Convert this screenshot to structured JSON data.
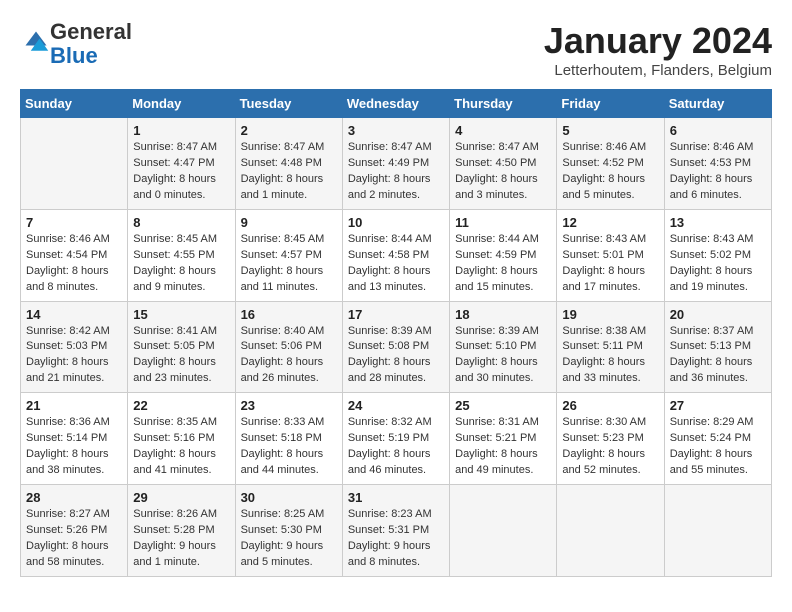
{
  "logo": {
    "general": "General",
    "blue": "Blue"
  },
  "title": "January 2024",
  "subtitle": "Letterhoutem, Flanders, Belgium",
  "weekdays": [
    "Sunday",
    "Monday",
    "Tuesday",
    "Wednesday",
    "Thursday",
    "Friday",
    "Saturday"
  ],
  "weeks": [
    [
      {
        "day": "",
        "info": ""
      },
      {
        "day": "1",
        "info": "Sunrise: 8:47 AM\nSunset: 4:47 PM\nDaylight: 8 hours\nand 0 minutes."
      },
      {
        "day": "2",
        "info": "Sunrise: 8:47 AM\nSunset: 4:48 PM\nDaylight: 8 hours\nand 1 minute."
      },
      {
        "day": "3",
        "info": "Sunrise: 8:47 AM\nSunset: 4:49 PM\nDaylight: 8 hours\nand 2 minutes."
      },
      {
        "day": "4",
        "info": "Sunrise: 8:47 AM\nSunset: 4:50 PM\nDaylight: 8 hours\nand 3 minutes."
      },
      {
        "day": "5",
        "info": "Sunrise: 8:46 AM\nSunset: 4:52 PM\nDaylight: 8 hours\nand 5 minutes."
      },
      {
        "day": "6",
        "info": "Sunrise: 8:46 AM\nSunset: 4:53 PM\nDaylight: 8 hours\nand 6 minutes."
      }
    ],
    [
      {
        "day": "7",
        "info": "Sunrise: 8:46 AM\nSunset: 4:54 PM\nDaylight: 8 hours\nand 8 minutes."
      },
      {
        "day": "8",
        "info": "Sunrise: 8:45 AM\nSunset: 4:55 PM\nDaylight: 8 hours\nand 9 minutes."
      },
      {
        "day": "9",
        "info": "Sunrise: 8:45 AM\nSunset: 4:57 PM\nDaylight: 8 hours\nand 11 minutes."
      },
      {
        "day": "10",
        "info": "Sunrise: 8:44 AM\nSunset: 4:58 PM\nDaylight: 8 hours\nand 13 minutes."
      },
      {
        "day": "11",
        "info": "Sunrise: 8:44 AM\nSunset: 4:59 PM\nDaylight: 8 hours\nand 15 minutes."
      },
      {
        "day": "12",
        "info": "Sunrise: 8:43 AM\nSunset: 5:01 PM\nDaylight: 8 hours\nand 17 minutes."
      },
      {
        "day": "13",
        "info": "Sunrise: 8:43 AM\nSunset: 5:02 PM\nDaylight: 8 hours\nand 19 minutes."
      }
    ],
    [
      {
        "day": "14",
        "info": "Sunrise: 8:42 AM\nSunset: 5:03 PM\nDaylight: 8 hours\nand 21 minutes."
      },
      {
        "day": "15",
        "info": "Sunrise: 8:41 AM\nSunset: 5:05 PM\nDaylight: 8 hours\nand 23 minutes."
      },
      {
        "day": "16",
        "info": "Sunrise: 8:40 AM\nSunset: 5:06 PM\nDaylight: 8 hours\nand 26 minutes."
      },
      {
        "day": "17",
        "info": "Sunrise: 8:39 AM\nSunset: 5:08 PM\nDaylight: 8 hours\nand 28 minutes."
      },
      {
        "day": "18",
        "info": "Sunrise: 8:39 AM\nSunset: 5:10 PM\nDaylight: 8 hours\nand 30 minutes."
      },
      {
        "day": "19",
        "info": "Sunrise: 8:38 AM\nSunset: 5:11 PM\nDaylight: 8 hours\nand 33 minutes."
      },
      {
        "day": "20",
        "info": "Sunrise: 8:37 AM\nSunset: 5:13 PM\nDaylight: 8 hours\nand 36 minutes."
      }
    ],
    [
      {
        "day": "21",
        "info": "Sunrise: 8:36 AM\nSunset: 5:14 PM\nDaylight: 8 hours\nand 38 minutes."
      },
      {
        "day": "22",
        "info": "Sunrise: 8:35 AM\nSunset: 5:16 PM\nDaylight: 8 hours\nand 41 minutes."
      },
      {
        "day": "23",
        "info": "Sunrise: 8:33 AM\nSunset: 5:18 PM\nDaylight: 8 hours\nand 44 minutes."
      },
      {
        "day": "24",
        "info": "Sunrise: 8:32 AM\nSunset: 5:19 PM\nDaylight: 8 hours\nand 46 minutes."
      },
      {
        "day": "25",
        "info": "Sunrise: 8:31 AM\nSunset: 5:21 PM\nDaylight: 8 hours\nand 49 minutes."
      },
      {
        "day": "26",
        "info": "Sunrise: 8:30 AM\nSunset: 5:23 PM\nDaylight: 8 hours\nand 52 minutes."
      },
      {
        "day": "27",
        "info": "Sunrise: 8:29 AM\nSunset: 5:24 PM\nDaylight: 8 hours\nand 55 minutes."
      }
    ],
    [
      {
        "day": "28",
        "info": "Sunrise: 8:27 AM\nSunset: 5:26 PM\nDaylight: 8 hours\nand 58 minutes."
      },
      {
        "day": "29",
        "info": "Sunrise: 8:26 AM\nSunset: 5:28 PM\nDaylight: 9 hours\nand 1 minute."
      },
      {
        "day": "30",
        "info": "Sunrise: 8:25 AM\nSunset: 5:30 PM\nDaylight: 9 hours\nand 5 minutes."
      },
      {
        "day": "31",
        "info": "Sunrise: 8:23 AM\nSunset: 5:31 PM\nDaylight: 9 hours\nand 8 minutes."
      },
      {
        "day": "",
        "info": ""
      },
      {
        "day": "",
        "info": ""
      },
      {
        "day": "",
        "info": ""
      }
    ]
  ]
}
